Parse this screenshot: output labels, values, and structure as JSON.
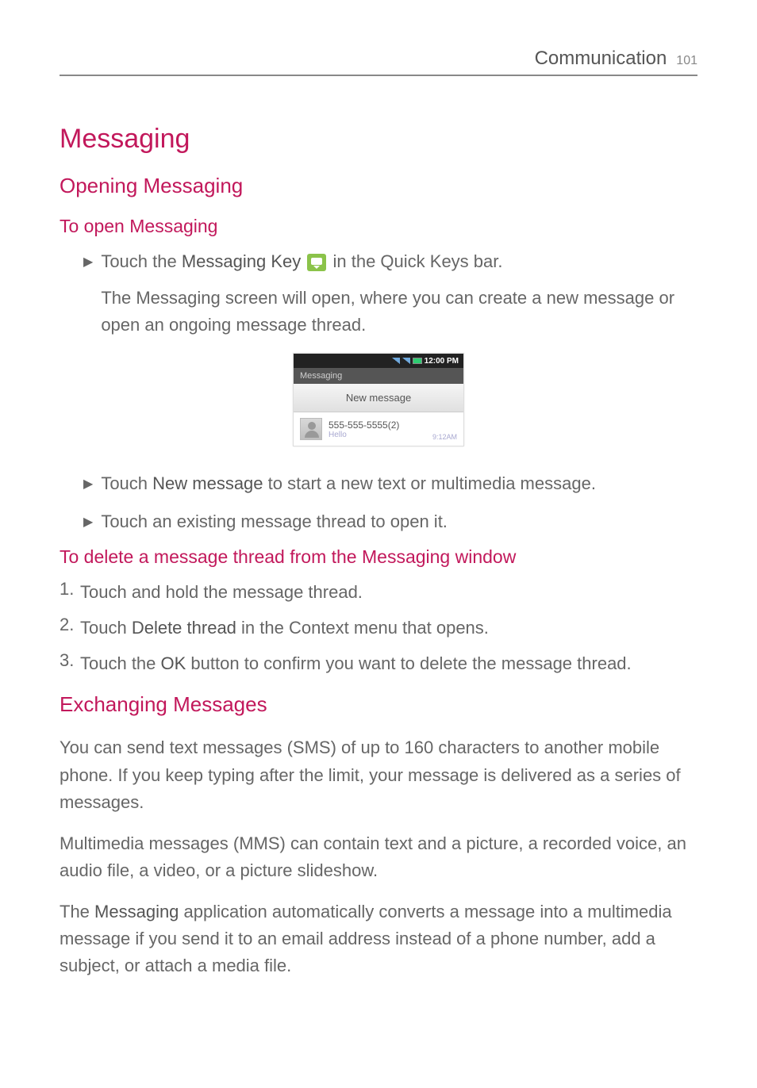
{
  "header": {
    "chapter": "Communication",
    "page": "101"
  },
  "title": "Messaging",
  "section1": {
    "title": "Opening Messaging",
    "subtitle": "To open Messaging",
    "bullet1_pre": "Touch the ",
    "bullet1_bold": "Messaging Key",
    "bullet1_post": " in the Quick Keys bar.",
    "bullet1_sub": "The Messaging screen will open, where you can create a new message or open an ongoing message thread.",
    "bullet2_pre": "Touch ",
    "bullet2_bold": "New message",
    "bullet2_post": " to start a new text or multimedia message.",
    "bullet3": "Touch an existing message thread to open it."
  },
  "screenshot": {
    "time": "12:00 PM",
    "app_title": "Messaging",
    "new_message": "New message",
    "thread_number": "555-555-5555(2)",
    "thread_preview": "Hello",
    "thread_time": "9:12AM"
  },
  "section2": {
    "title": "To delete a message thread from the Messaging window",
    "item1": "Touch and hold the message thread.",
    "item2_pre": "Touch ",
    "item2_bold": "Delete thread",
    "item2_post": " in the Context menu that opens.",
    "item3_pre": "Touch the ",
    "item3_bold": "OK",
    "item3_post": " button to confirm you want to delete the message thread."
  },
  "section3": {
    "title": "Exchanging Messages",
    "para1": "You can send text messages (SMS) of up to 160 characters to another mobile phone. If you keep typing after the limit, your message is delivered as a series of messages.",
    "para2": "Multimedia messages (MMS) can contain text and a picture, a recorded voice, an audio file, a video, or a picture slideshow.",
    "para3_pre": "The ",
    "para3_bold": "Messaging",
    "para3_post": " application automatically converts a message into a multimedia message if you send it to an email address instead of a phone number, add a subject, or attach a media file."
  }
}
